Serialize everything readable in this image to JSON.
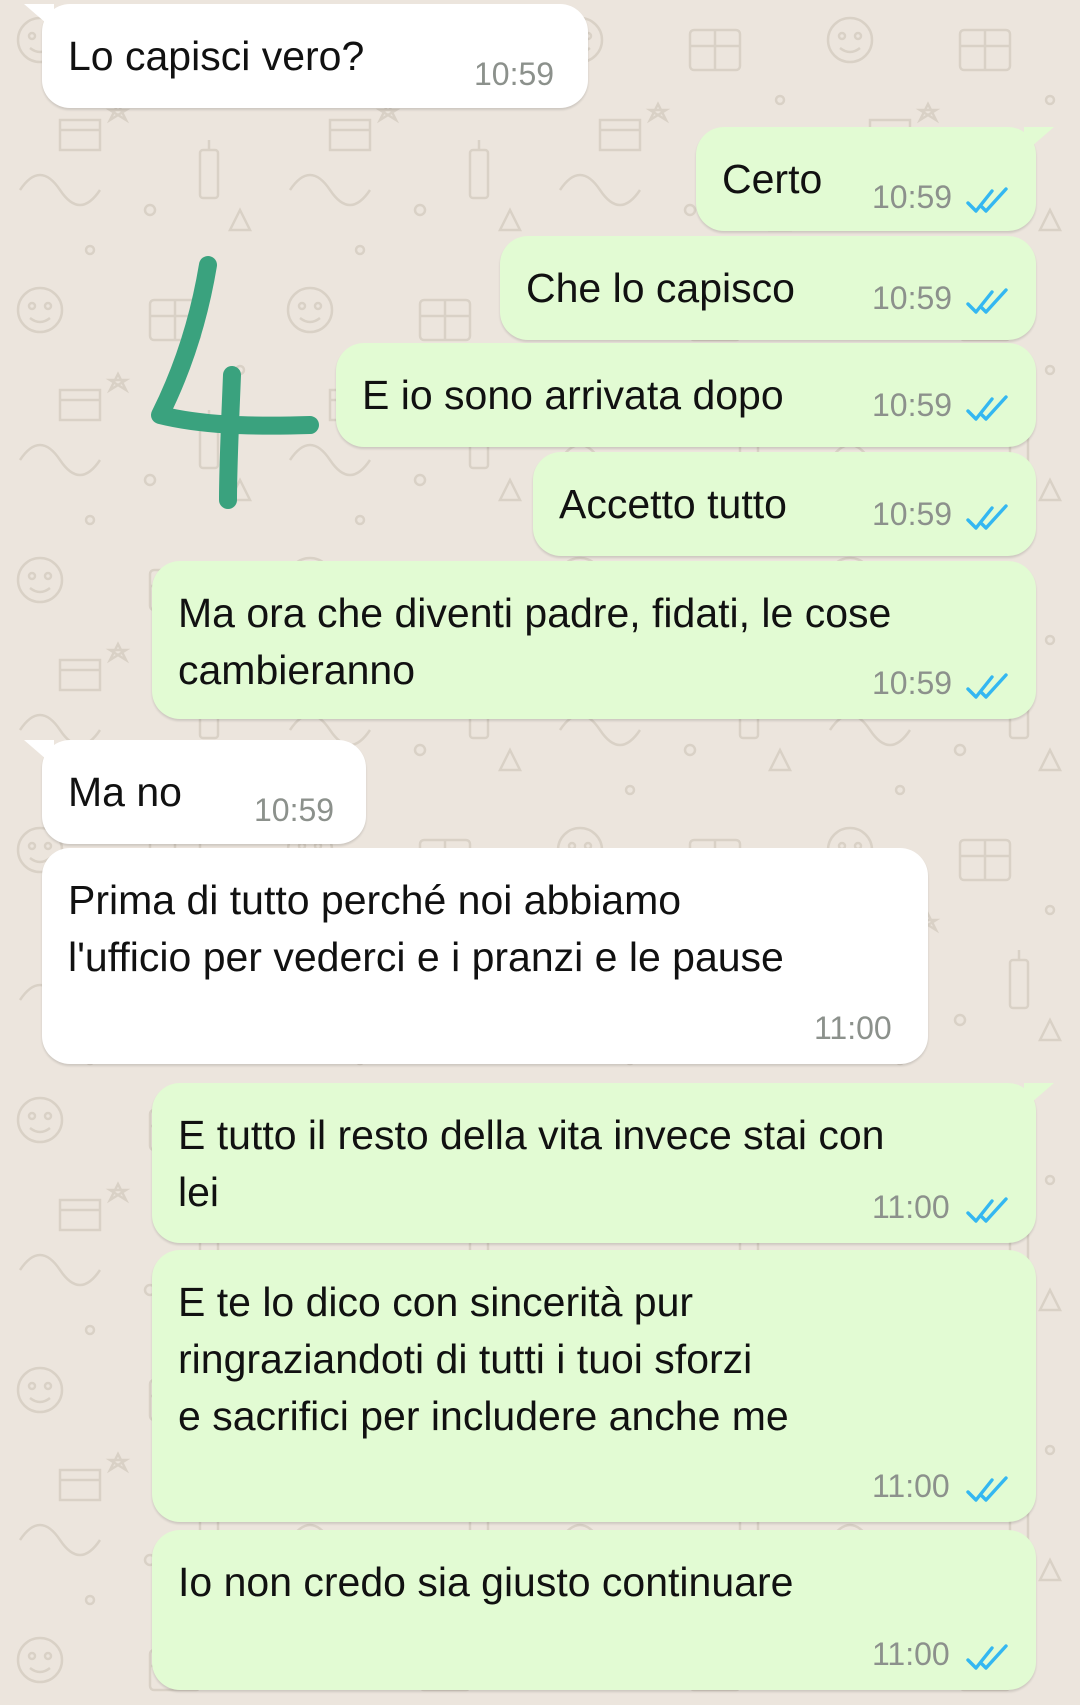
{
  "colors": {
    "incoming_bubble": "#ffffff",
    "outgoing_bubble": "#e2fbd3",
    "read_ticks": "#34b7f1",
    "annotation_mark": "#3aa27e",
    "wallpaper": "#ece5dd"
  },
  "annotation": {
    "icon": "handwritten-number-4"
  },
  "messages": [
    {
      "direction": "in",
      "lines": [
        "Lo capisci vero?"
      ],
      "time": "10:59",
      "status": null
    },
    {
      "direction": "out",
      "lines": [
        "Certo"
      ],
      "time": "10:59",
      "status": "read"
    },
    {
      "direction": "out",
      "lines": [
        "Che lo capisco"
      ],
      "time": "10:59",
      "status": "read"
    },
    {
      "direction": "out",
      "lines": [
        "E io sono arrivata dopo"
      ],
      "time": "10:59",
      "status": "read"
    },
    {
      "direction": "out",
      "lines": [
        "Accetto tutto"
      ],
      "time": "10:59",
      "status": "read"
    },
    {
      "direction": "out",
      "lines": [
        "Ma ora che diventi padre, fidati, le cose",
        "cambieranno"
      ],
      "time": "10:59",
      "status": "read"
    },
    {
      "direction": "in",
      "lines": [
        "Ma no"
      ],
      "time": "10:59",
      "status": null
    },
    {
      "direction": "in",
      "lines": [
        "Prima di tutto perché noi abbiamo",
        "l'ufficio per vederci e i pranzi e le pause"
      ],
      "time": "11:00",
      "status": null
    },
    {
      "direction": "out",
      "lines": [
        "E tutto il resto della vita invece stai con",
        "lei"
      ],
      "time": "11:00",
      "status": "read"
    },
    {
      "direction": "out",
      "lines": [
        "E te lo dico con sincerità pur",
        "ringraziandoti di tutti i tuoi sforzi",
        "e sacrifici per includere anche me"
      ],
      "time": "11:00",
      "status": "read"
    },
    {
      "direction": "out",
      "lines": [
        "Io non credo sia giusto continuare"
      ],
      "time": "11:00",
      "status": "read"
    }
  ]
}
